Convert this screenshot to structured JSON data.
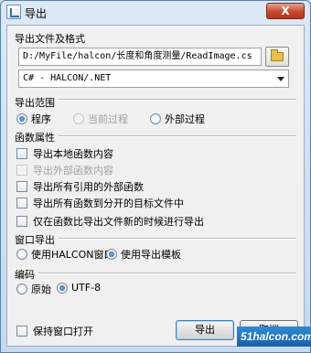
{
  "window": {
    "title": "导出",
    "close_label": "X"
  },
  "export_file": {
    "label": "导出文件及格式",
    "path": "D:/MyFile/halcon/长度和角度测量/ReadImage.cs",
    "format": "C# - HALCON/.NET"
  },
  "export_scope": {
    "label": "导出范围",
    "options": [
      {
        "label": "程序",
        "selected": true,
        "enabled": true
      },
      {
        "label": "当前过程",
        "selected": false,
        "enabled": false
      },
      {
        "label": "外部过程",
        "selected": false,
        "enabled": true
      }
    ]
  },
  "function_properties": {
    "label": "函数属性",
    "options": [
      {
        "label": "导出本地函数内容",
        "checked": false,
        "enabled": true
      },
      {
        "label": "导出外部函数内容",
        "checked": false,
        "enabled": false
      },
      {
        "label": "导出所有引用的外部函数",
        "checked": false,
        "enabled": true
      },
      {
        "label": "导出所有函数到分开的目标文件中",
        "checked": false,
        "enabled": true
      },
      {
        "label": "仅在函数比导出文件新的时候进行导出",
        "checked": false,
        "enabled": true
      }
    ]
  },
  "window_export": {
    "label": "窗口导出",
    "options": [
      {
        "label": "使用HALCON窗口",
        "selected": false
      },
      {
        "label": "使用导出模板",
        "selected": true
      }
    ]
  },
  "encoding": {
    "label": "编码",
    "options": [
      {
        "label": "原始",
        "selected": false
      },
      {
        "label": "UTF-8",
        "selected": true
      }
    ]
  },
  "footer": {
    "keep_open_label": "保持窗口打开",
    "export_button": "导出",
    "cancel_button": "取消"
  },
  "watermark": "51halcon.com"
}
